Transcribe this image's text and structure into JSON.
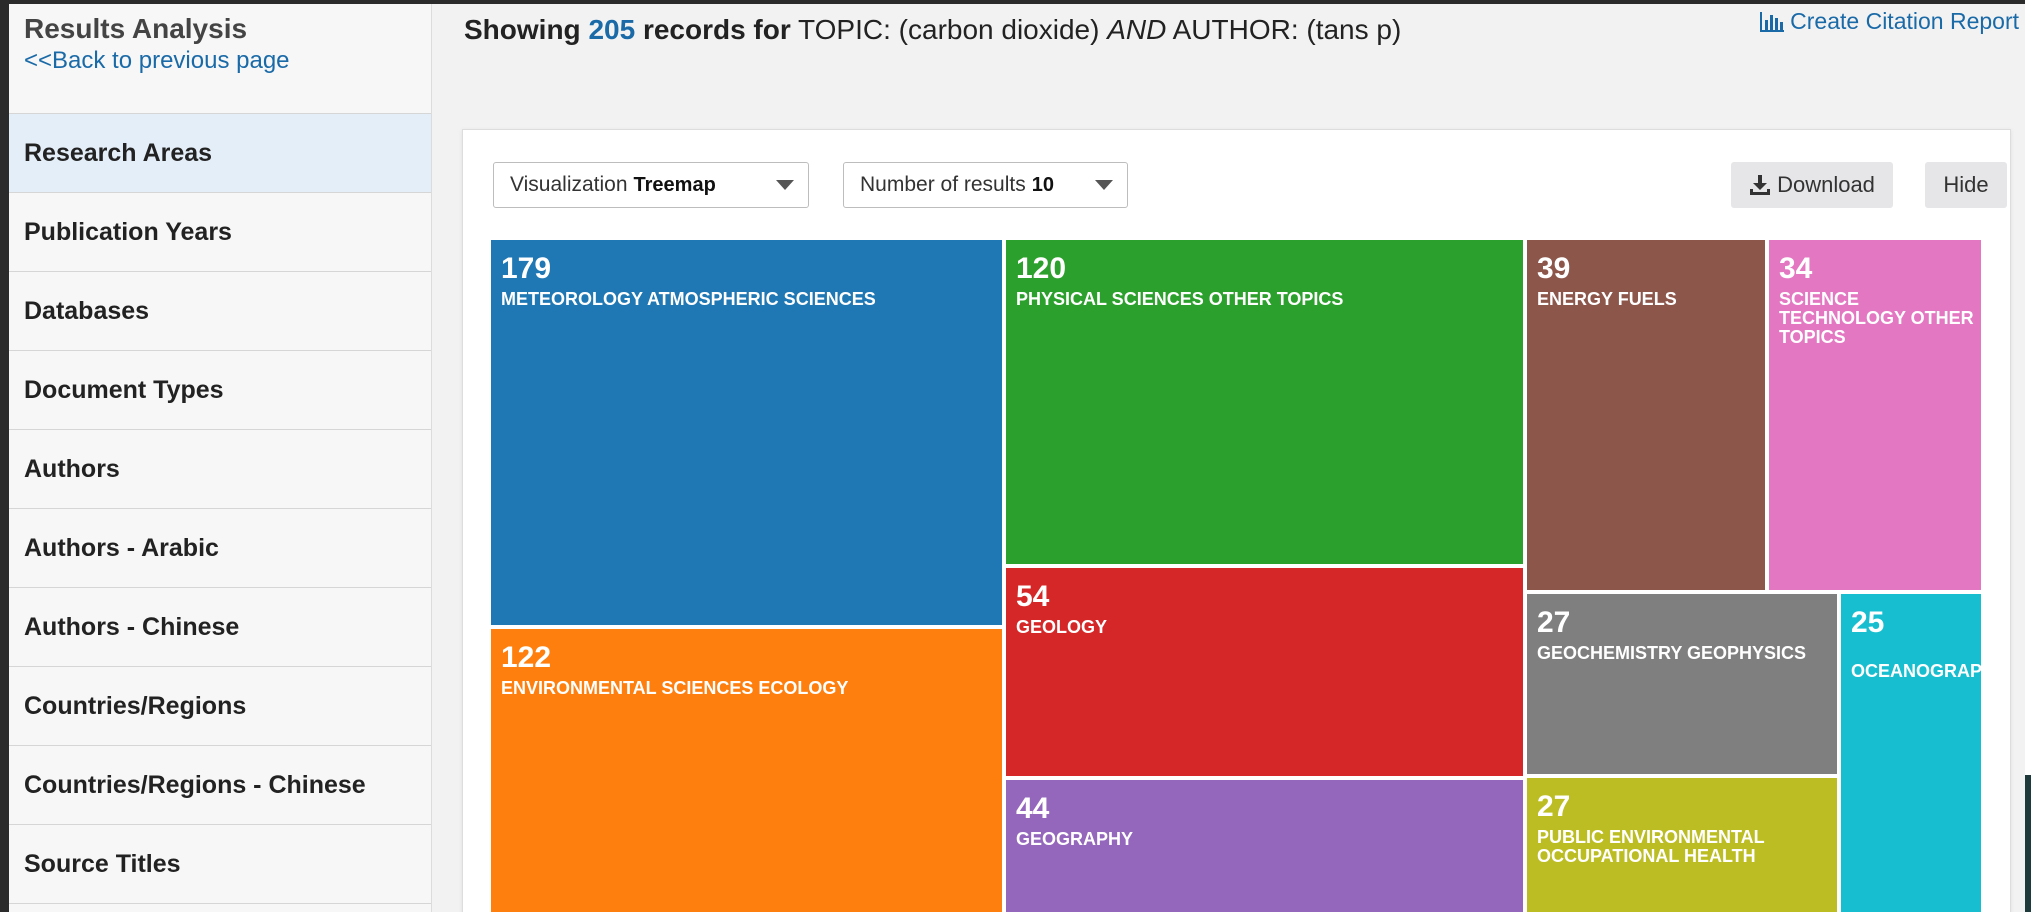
{
  "sidebar": {
    "title": "Results Analysis",
    "back_link": "<<Back to previous page",
    "items": [
      {
        "label": "Research Areas",
        "active": true
      },
      {
        "label": "Publication Years",
        "active": false
      },
      {
        "label": "Databases",
        "active": false
      },
      {
        "label": "Document Types",
        "active": false
      },
      {
        "label": "Authors",
        "active": false
      },
      {
        "label": "Authors - Arabic",
        "active": false
      },
      {
        "label": "Authors - Chinese",
        "active": false
      },
      {
        "label": "Countries/Regions",
        "active": false
      },
      {
        "label": "Countries/Regions - Chinese",
        "active": false
      },
      {
        "label": "Source Titles",
        "active": false
      }
    ]
  },
  "summary": {
    "showing": "Showing",
    "count": "205",
    "records_for": "records for",
    "topic_label": "TOPIC:",
    "topic_value": "(carbon dioxide)",
    "and": "AND",
    "author_label": "AUTHOR:",
    "author_value": "(tans p)"
  },
  "citation_report": {
    "label": "Create Citation Report",
    "icon": "bar-chart-icon"
  },
  "controls": {
    "visualization_label": "Visualization",
    "visualization_value": "Treemap",
    "results_label": "Number of results",
    "results_value": "10",
    "download_label": "Download",
    "download_icon": "download-icon",
    "hide_label": "Hide"
  },
  "colors": {
    "link": "#1a6aa8",
    "active_nav": "#e4eef8"
  },
  "chart_data": {
    "type": "treemap",
    "items": [
      {
        "label": "METEOROLOGY ATMOSPHERIC SCIENCES",
        "value": 179,
        "color": "#1f77b4"
      },
      {
        "label": "ENVIRONMENTAL SCIENCES ECOLOGY",
        "value": 122,
        "color": "#ff7f0e"
      },
      {
        "label": "PHYSICAL SCIENCES OTHER TOPICS",
        "value": 120,
        "color": "#2ca02c"
      },
      {
        "label": "GEOLOGY",
        "value": 54,
        "color": "#d62728"
      },
      {
        "label": "GEOGRAPHY",
        "value": 44,
        "color": "#9467bd"
      },
      {
        "label": "ENERGY FUELS",
        "value": 39,
        "color": "#8c564b"
      },
      {
        "label": "SCIENCE TECHNOLOGY OTHER TOPICS",
        "value": 34,
        "color": "#e377c2"
      },
      {
        "label": "GEOCHEMISTRY GEOPHYSICS",
        "value": 27,
        "color": "#7f7f7f"
      },
      {
        "label": "PUBLIC ENVIRONMENTAL OCCUPATIONAL HEALTH",
        "value": 27,
        "color": "#bcbd22"
      },
      {
        "label": "OCEANOGRAPHY",
        "value": 25,
        "color": "#17becf"
      }
    ]
  }
}
